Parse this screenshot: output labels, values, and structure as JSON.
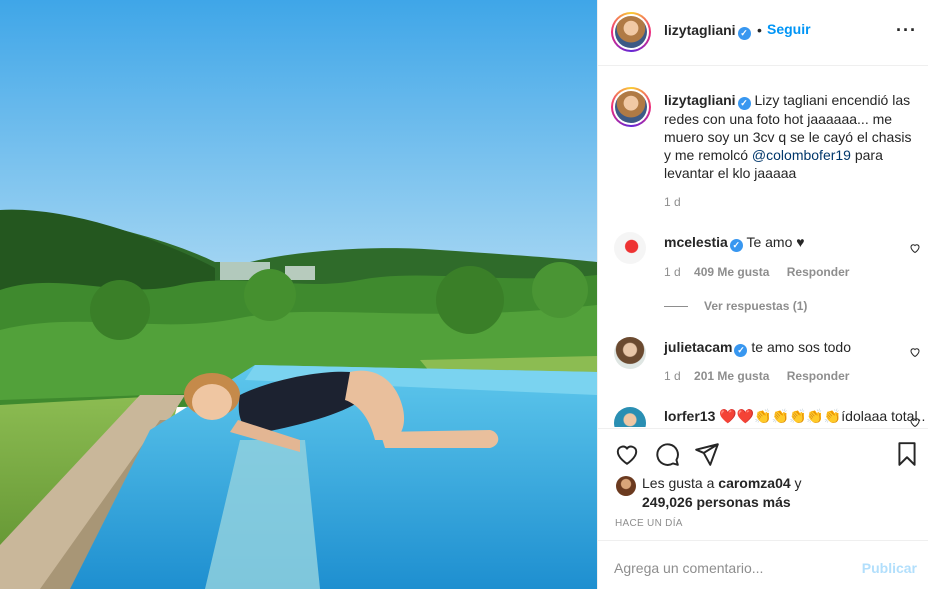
{
  "post": {
    "username": "lizytagliani",
    "follow_label": "Seguir",
    "dot": "•",
    "more_icon": "more-options-icon",
    "caption_text_1": "Lizy tagliani encendió las redes con una foto hot jaaaaaa... me muero soy un 3cv q se le cayó el chasis y me remolcó ",
    "caption_mention": "@colombofer19",
    "caption_text_2": " para levantar el klo jaaaaa",
    "caption_time": "1 d"
  },
  "comments": [
    {
      "user": "mcelestia",
      "text": "Te amo ♥",
      "time": "1 d",
      "likes": "409 Me gusta",
      "reply": "Responder",
      "view_replies": "Ver respuestas (1)"
    },
    {
      "user": "julietacam",
      "text": "te amo sos todo",
      "time": "1 d",
      "likes": "201 Me gusta",
      "reply": "Responder"
    },
    {
      "user": "lorfer13",
      "text": "❤️❤️👏👏👏👏👏ídolaaa total.."
    }
  ],
  "actions": {
    "icons": [
      "heart-icon",
      "comment-icon",
      "share-icon",
      "bookmark-icon"
    ],
    "likes_prefix": "Les gusta a ",
    "likes_user": "caromza04",
    "likes_join": " y",
    "likes_count": "249,026 personas más",
    "posted": "HACE UN DÍA"
  },
  "add_comment": {
    "placeholder": "Agrega un comentario...",
    "publish": "Publicar"
  },
  "colors": {
    "accent": "#0095f6",
    "verified": "#3897f0",
    "publish_disabled": "#b2dffc",
    "muted": "#8e8e8e"
  }
}
